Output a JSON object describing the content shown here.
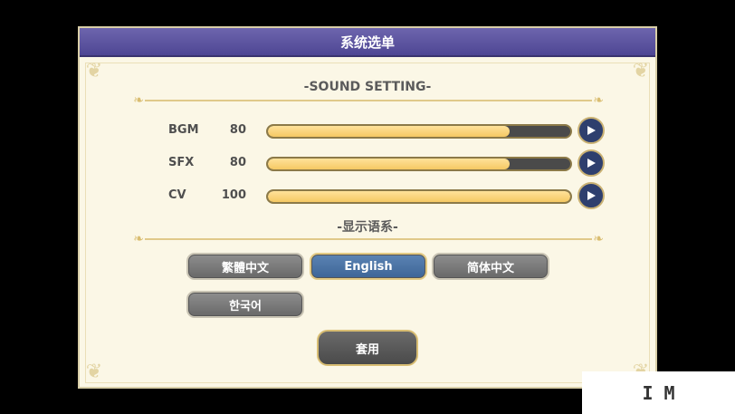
{
  "window": {
    "title": "系统选单"
  },
  "sound": {
    "section_title": "-SOUND SETTING-",
    "items": [
      {
        "label": "BGM",
        "value": "80",
        "level_pct": 80
      },
      {
        "label": "SFX",
        "value": "80",
        "level_pct": 80
      },
      {
        "label": "CV",
        "value": "100",
        "level_pct": 100
      }
    ]
  },
  "language": {
    "section_title": "-显示语系-",
    "options": [
      {
        "label": "繁體中文",
        "selected": false
      },
      {
        "label": "English",
        "selected": true
      },
      {
        "label": "简体中文",
        "selected": false
      },
      {
        "label": "한국어",
        "selected": false
      }
    ]
  },
  "apply_button": "套用",
  "watermark": "I  M"
}
